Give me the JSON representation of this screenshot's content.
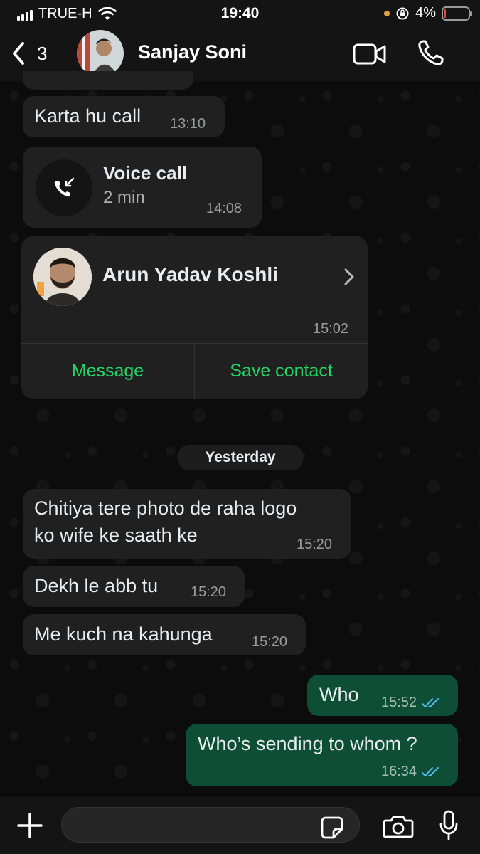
{
  "status_bar": {
    "carrier": "TRUE-H",
    "time": "19:40",
    "battery": "4%",
    "battery_level": 0.04
  },
  "header": {
    "back_count": "3",
    "contact_name": "Sanjay Soni"
  },
  "messages": [
    {
      "type": "text",
      "direction": "in",
      "text": "Karta hu call",
      "time": "13:10"
    },
    {
      "type": "call",
      "direction": "in",
      "title": "Voice call",
      "duration": "2 min",
      "time": "14:08"
    },
    {
      "type": "contact",
      "direction": "in",
      "name": "Arun Yadav Koshli",
      "time": "15:02",
      "actions": [
        "Message",
        "Save contact"
      ]
    },
    {
      "type": "date",
      "label": "Yesterday"
    },
    {
      "type": "text",
      "direction": "in",
      "text": "Chitiya tere photo de raha logo\nko wife ke saath ke",
      "time": "15:20"
    },
    {
      "type": "text",
      "direction": "in",
      "text": "Dekh le abb tu",
      "time": "15:20"
    },
    {
      "type": "text",
      "direction": "in",
      "text": "Me kuch na kahunga",
      "time": "15:20"
    },
    {
      "type": "text",
      "direction": "out",
      "text": "Who",
      "time": "15:52",
      "status": "read"
    },
    {
      "type": "text",
      "direction": "out",
      "text": "Who’s sending to whom ?",
      "time": "16:34",
      "status": "read"
    }
  ],
  "colors": {
    "incoming_bubble": "#202020",
    "outgoing_bubble": "#0e4e36",
    "accent_green": "#25d366",
    "read_tick": "#53bdeb"
  },
  "icons": {
    "back": "chevron-left-icon",
    "video": "video-camera-icon",
    "phone": "phone-icon",
    "call": "incoming-call-icon",
    "plus": "plus-icon",
    "sticker": "sticker-icon",
    "camera": "camera-icon",
    "mic": "microphone-icon"
  }
}
